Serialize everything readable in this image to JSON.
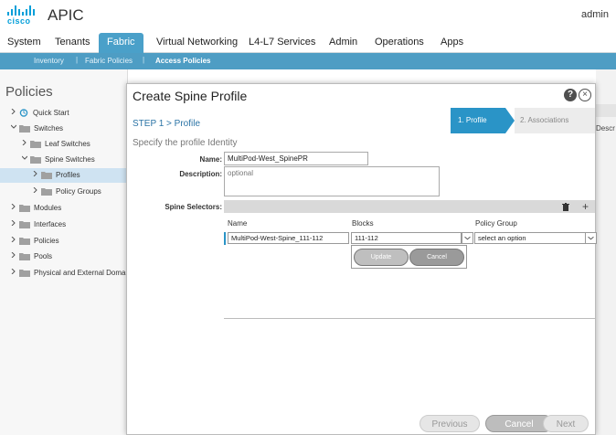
{
  "header": {
    "logo_text": "cisco",
    "app_name": "APIC",
    "user": "admin"
  },
  "nav": {
    "tabs": [
      "System",
      "Tenants",
      "Fabric",
      "Virtual Networking",
      "L4-L7 Services",
      "Admin",
      "Operations",
      "Apps"
    ],
    "active": "Fabric"
  },
  "subnav": {
    "items": [
      "Inventory",
      "Fabric Policies",
      "Access Policies"
    ],
    "separator": "|"
  },
  "sidebar": {
    "title": "Policies",
    "items": [
      {
        "label": "Quick Start"
      },
      {
        "label": "Switches"
      },
      {
        "label": "Leaf Switches"
      },
      {
        "label": "Spine Switches"
      },
      {
        "label": "Profiles"
      },
      {
        "label": "Policy Groups"
      },
      {
        "label": "Modules"
      },
      {
        "label": "Interfaces"
      },
      {
        "label": "Policies"
      },
      {
        "label": "Pools"
      },
      {
        "label": "Physical and External Domains"
      }
    ]
  },
  "right_strip": {
    "label": "Descr"
  },
  "modal": {
    "title": "Create Spine Profile",
    "step_title": "STEP 1 > Profile",
    "wizard": {
      "step1": "1. Profile",
      "step2": "2. Associations"
    },
    "section": "Specify the profile Identity",
    "fields": {
      "name_label": "Name:",
      "name_value": "MultiPod-West_SpinePR",
      "description_label": "Description:",
      "description_value": "optional",
      "selectors_label": "Spine Selectors:"
    },
    "table": {
      "headers": [
        "Name",
        "Blocks",
        "Policy Group"
      ],
      "row": {
        "name": "MultiPod-West-Spine_111-112",
        "blocks": "111-112",
        "policy_group": "select an option"
      }
    },
    "popup": {
      "update": "Update",
      "cancel": "Cancel"
    },
    "footer": {
      "previous": "Previous",
      "cancel": "Cancel",
      "next": "Next"
    }
  }
}
